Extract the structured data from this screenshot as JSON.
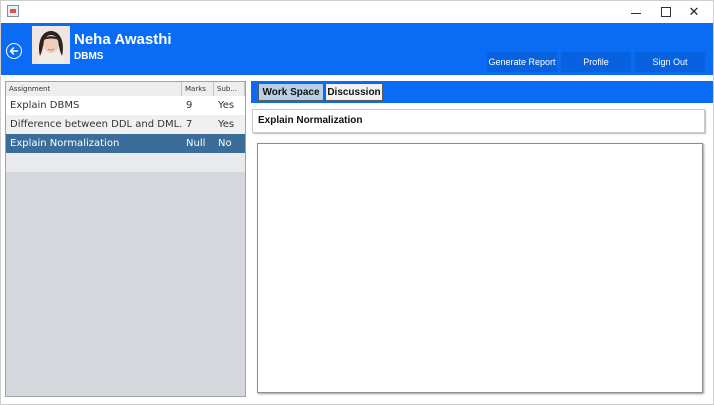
{
  "window": {
    "controls": {
      "minimize": "minimize",
      "maximize": "maximize",
      "close": "✕"
    }
  },
  "header": {
    "user_name": "Neha Awasthi",
    "course": "DBMS",
    "buttons": {
      "generate_report": "Generate Report",
      "profile": "Profile",
      "sign_out": "Sign Out"
    },
    "icons": {
      "back": "back-arrow-icon",
      "avatar": "user-avatar"
    }
  },
  "assignments_table": {
    "columns": [
      "Assignment",
      "Marks",
      "Sub..."
    ],
    "rows": [
      {
        "assignment": "Explain DBMS",
        "marks": "9",
        "submitted": "Yes"
      },
      {
        "assignment": "Difference between DDL and DML...",
        "marks": "7",
        "submitted": "Yes"
      },
      {
        "assignment": "Explain Normalization",
        "marks": "Null",
        "submitted": "No"
      }
    ],
    "selected_index": 2
  },
  "tabs": {
    "workspace": "Work Space",
    "discussion": "Discussion",
    "active": "Work Space"
  },
  "question": {
    "title": "Explain Normalization"
  },
  "colors": {
    "header_blue": "#0a6cf5",
    "selected_row": "#3a6d9a",
    "active_tab": "#b8cfe6"
  }
}
